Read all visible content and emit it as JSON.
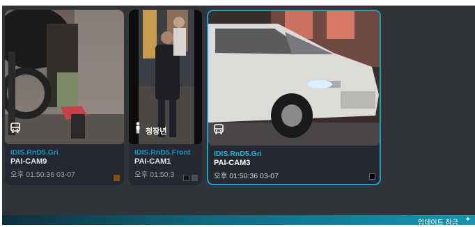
{
  "cards": [
    {
      "site": "IDIS.RnD5.Gri",
      "camera": "PAI-CAM9",
      "time": "오후 01:50:36 03-07",
      "badge_icon": "bus-icon",
      "badge_text": "",
      "flags": [
        "#8a4c12"
      ]
    },
    {
      "site": "IDIS.RnD5.Front",
      "camera": "PAI-CAM1",
      "time": "오후 01:50:3",
      "badge_icon": "person-icon",
      "badge_text": "청장년",
      "flags": [
        "#111111",
        "#4c4c4c"
      ]
    },
    {
      "site": "IDIS.RnD5.Gri",
      "camera": "PAI-CAM3",
      "time": "오후 01:50:36 03-07",
      "badge_icon": "bus-icon",
      "badge_text": "",
      "flags": [
        "#000000"
      ]
    }
  ],
  "footer": {
    "label": "업데이트 잠금",
    "icon": "pin-icon"
  },
  "colors": {
    "panel": "#303337",
    "accent": "#1aa3c6",
    "site_text": "#1597c4"
  }
}
